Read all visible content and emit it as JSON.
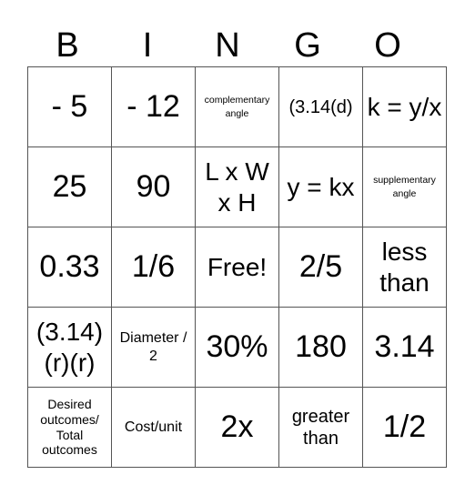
{
  "header": [
    "B",
    "I",
    "N",
    "G",
    "O"
  ],
  "rows": [
    [
      "- 5",
      "- 12",
      "complementary angle",
      "(3.14(d)",
      "k = y/x"
    ],
    [
      "25",
      "90",
      "L x W x H",
      "y = kx",
      "supplementary angle"
    ],
    [
      "0.33",
      "1/6",
      "Free!",
      "2/5",
      "less than"
    ],
    [
      "(3.14) (r)(r)",
      "Diameter / 2",
      "30%",
      "180",
      "3.14"
    ],
    [
      "Desired outcomes/ Total outcomes",
      "Cost/unit",
      "2x",
      "greater than",
      "1/2"
    ]
  ]
}
